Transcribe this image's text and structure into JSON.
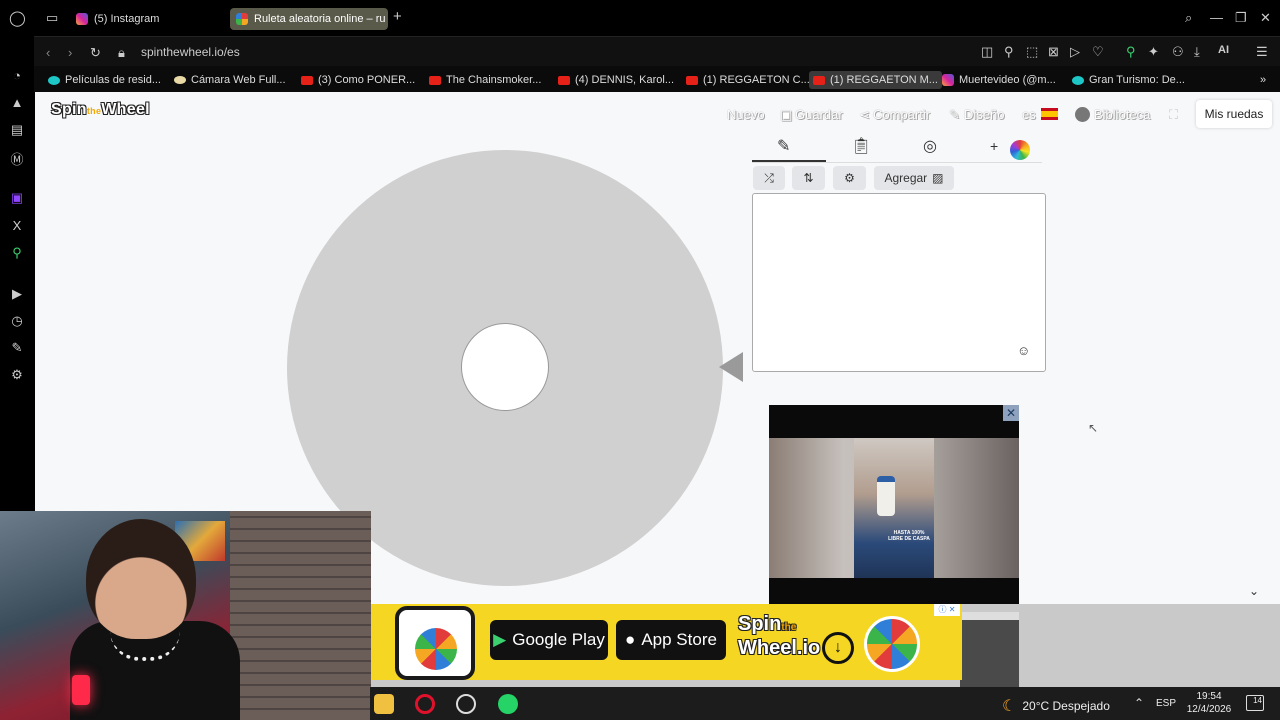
{
  "browser": {
    "tabs": [
      {
        "label": "(5) Instagram",
        "active": false
      },
      {
        "label": "Ruleta aleatoria online – ru",
        "active": true
      }
    ],
    "new_tab": "+",
    "url": "spinthewheel.io/es",
    "bookmarks": [
      {
        "label": "Películas de resid..."
      },
      {
        "label": "Cámara Web Full..."
      },
      {
        "label": "(3) Como PONER..."
      },
      {
        "label": "The Chainsmoker..."
      },
      {
        "label": "(4) DENNIS, Karol..."
      },
      {
        "label": "(1) REGGAETON C..."
      },
      {
        "label": "(1) REGGAETON M...",
        "active": true
      },
      {
        "label": "Muertevideo (@m..."
      },
      {
        "label": "Gran Turismo: De..."
      }
    ],
    "ai_label": "AI"
  },
  "site": {
    "logo": "Spin",
    "logo_mid": "the",
    "logo_end": "Wheel",
    "nav": {
      "nuevo": "Nuevo",
      "guardar": "Guardar",
      "compartir": "Compartir",
      "diseno": "Diseño",
      "lang": "es",
      "biblioteca": "Biblioteca",
      "mis_ruedas": "Mis ruedas"
    },
    "editor": {
      "agregar": "Agregar",
      "plus": "+"
    }
  },
  "ads": {
    "caption": "HASTA 100% LIBRE DE CASPA",
    "close": "✕",
    "google_play": "Google Play",
    "app_store": "App Store",
    "banner_logo_1": "Spin",
    "banner_logo_2": "the",
    "banner_logo_3": "Wheel.io",
    "adchoice": "ⓘ ✕"
  },
  "taskbar": {
    "weather": "20°C  Despejado",
    "lang": "ESP",
    "time": "19:54",
    "date": "12/4/2026",
    "notifications": "14"
  },
  "colors": {
    "wheel": "#d0d0d0",
    "accent_active_tab": "#5a5a4a",
    "banner_yellow": "#f5d623"
  }
}
